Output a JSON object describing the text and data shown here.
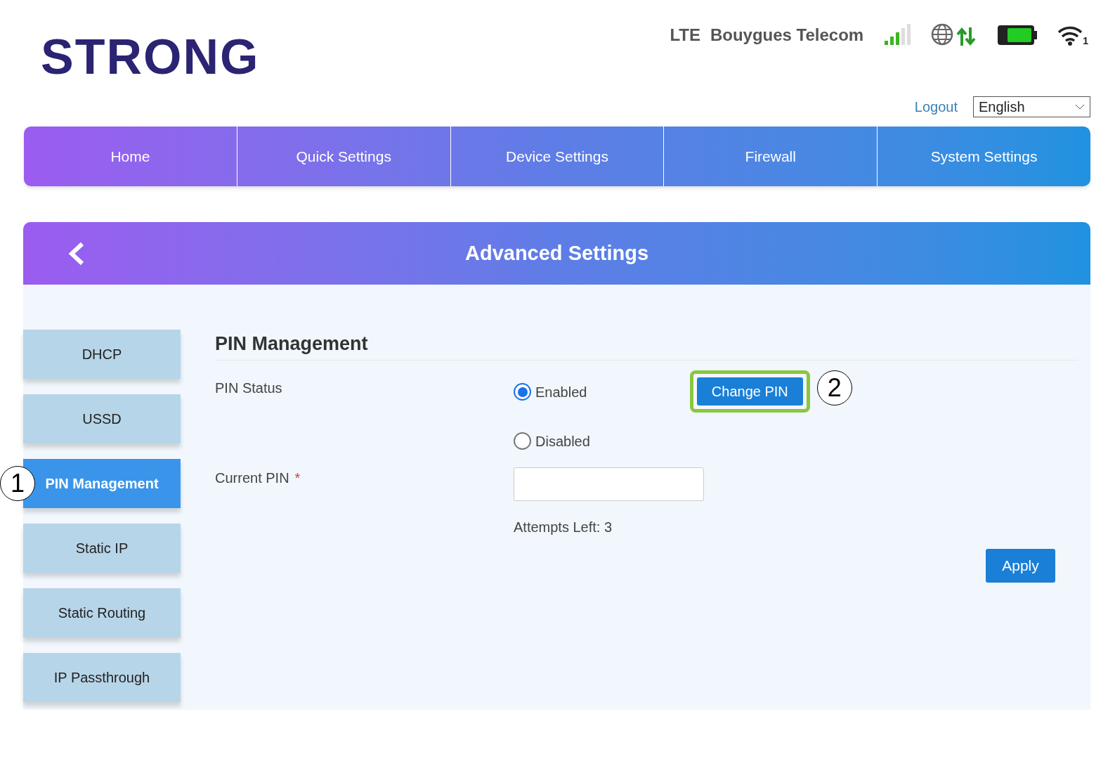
{
  "logo": "STRONG",
  "status": {
    "network": "LTE",
    "carrier": "Bouygues Telecom",
    "wifi_clients": "1"
  },
  "logout": "Logout",
  "language": "English",
  "nav": [
    {
      "label": "Home",
      "selected": false
    },
    {
      "label": "Quick Settings",
      "selected": false
    },
    {
      "label": "Device Settings",
      "selected": false
    },
    {
      "label": "Firewall",
      "selected": false
    },
    {
      "label": "System Settings",
      "selected": false
    }
  ],
  "panel_title": "Advanced Settings",
  "sidebar": [
    {
      "label": "DHCP",
      "selected": false
    },
    {
      "label": "USSD",
      "selected": false
    },
    {
      "label": "PIN Management",
      "selected": true,
      "callout": "1"
    },
    {
      "label": "Static IP",
      "selected": false
    },
    {
      "label": "Static Routing",
      "selected": false
    },
    {
      "label": "IP Passthrough",
      "selected": false
    }
  ],
  "section_title": "PIN Management",
  "pin_status": {
    "label": "PIN Status",
    "options": [
      {
        "label": "Enabled",
        "selected": true
      },
      {
        "label": "Disabled",
        "selected": false
      }
    ]
  },
  "change_pin": {
    "label": "Change PIN",
    "highlighted": true,
    "callout": "2"
  },
  "current_pin": {
    "label": "Current PIN",
    "required_mark": "*"
  },
  "attempts": "Attempts Left: 3",
  "apply": "Apply"
}
